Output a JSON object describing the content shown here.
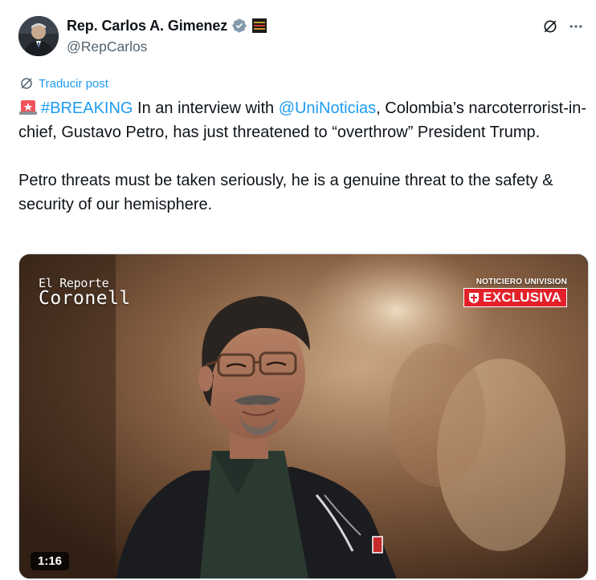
{
  "author": {
    "display_name": "Rep. Carlos A. Gimenez",
    "handle": "@RepCarlos",
    "verified_icon": "verified-badge-icon",
    "affiliate_badge_icon": "government-affiliate-badge-icon"
  },
  "actions": {
    "grok_icon": "grok-icon",
    "more_icon": "more-horizontal-icon"
  },
  "translate": {
    "label": "Traducir post"
  },
  "tweet": {
    "siren_emoji": "🚨",
    "hashtag": "#BREAKING",
    "text_a": " In an interview with ",
    "mention": "@UniNoticias",
    "text_b": ", Colombia’s narcoterrorist-in-chief, Gustavo Petro, has just threatened to “overthrow” President Trump.",
    "paragraph2": "Petro threats must be taken seriously, he is a genuine threat to the safety & security of our hemisphere."
  },
  "video": {
    "brand_small": "El Reporte",
    "brand_big": "Coronell",
    "network": "NOTICIERO UNIVISION",
    "exclusive": "EXCLUSIVA",
    "duration": "1:16"
  },
  "colors": {
    "link": "#1d9bf0",
    "text": "#0f1419",
    "muted": "#536471",
    "verified": "#829aab",
    "exclusive_red": "#e3202a"
  }
}
